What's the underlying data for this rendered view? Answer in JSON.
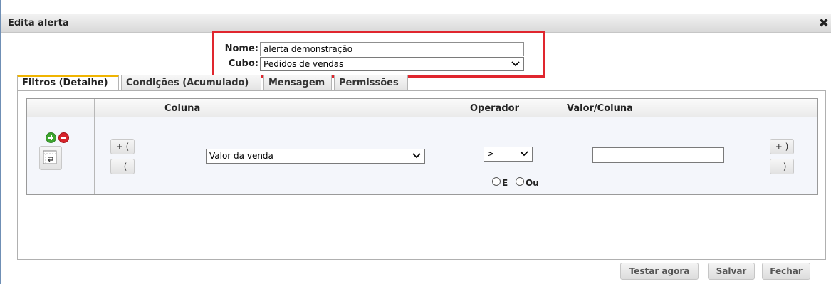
{
  "dialog": {
    "title": "Edita alerta",
    "close_glyph": "✖",
    "close_icon": "close-icon"
  },
  "form": {
    "nome_label": "Nome:",
    "nome_value": "alerta demonstração",
    "cubo_label": "Cubo:",
    "cubo_value": "Pedidos de vendas"
  },
  "tabs": [
    {
      "label": "Filtros (Detalhe)",
      "active": true
    },
    {
      "label": "Condições (Acumulado)",
      "active": false
    },
    {
      "label": "Mensagem",
      "active": false
    },
    {
      "label": "Permissões",
      "active": false
    }
  ],
  "grid": {
    "headers": {
      "coluna": "Coluna",
      "operador": "Operador",
      "valor": "Valor/Coluna"
    },
    "row": {
      "open_paren_add": "+ (",
      "open_paren_remove": "- (",
      "coluna_value": "Valor da venda",
      "operador_value": ">",
      "valor_value": "",
      "close_paren_add": "+ )",
      "close_paren_remove": "- )",
      "logic_e": "E",
      "logic_ou": "Ou"
    }
  },
  "footer": {
    "test_label": "Testar agora",
    "save_label": "Salvar",
    "close_label": "Fechar"
  },
  "colors": {
    "highlight": "#e0262e",
    "active_tab": "#f0b400",
    "add_icon": "#3ea52f",
    "remove_icon": "#d7232b"
  }
}
